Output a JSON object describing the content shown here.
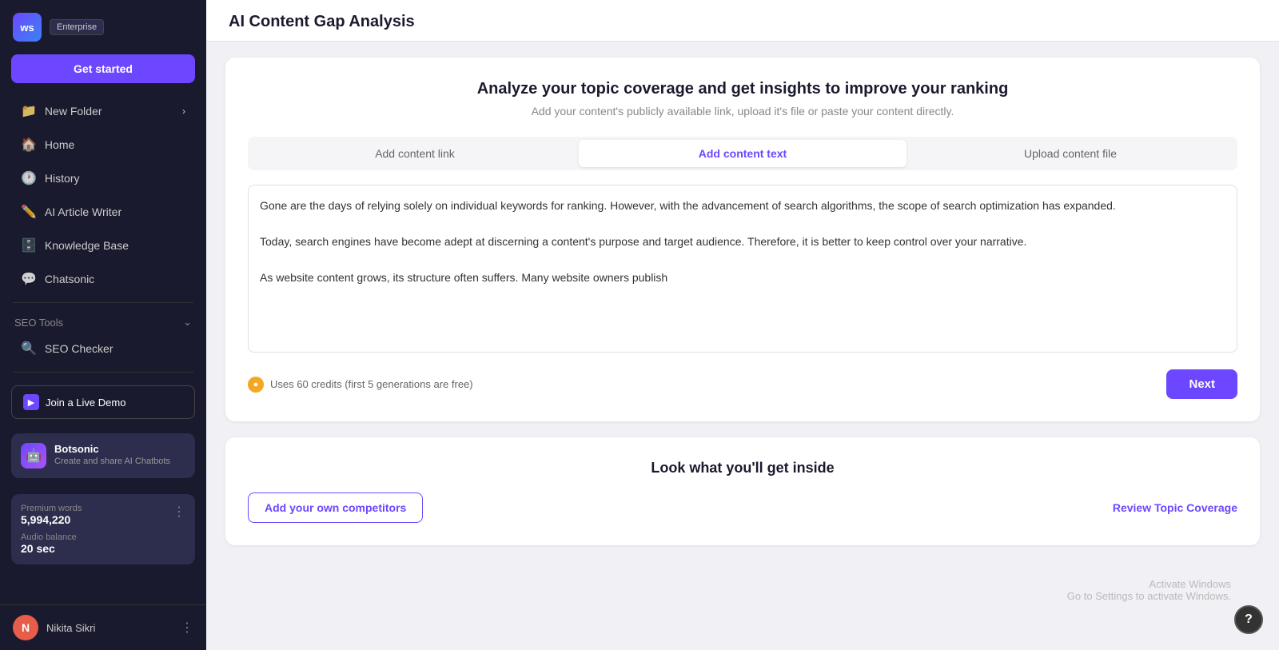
{
  "sidebar": {
    "logo_text": "ws",
    "enterprise_label": "Enterprise",
    "get_started_label": "Get started",
    "items": [
      {
        "id": "new-folder",
        "label": "New Folder",
        "icon": "📁",
        "has_chevron": true
      },
      {
        "id": "home",
        "label": "Home",
        "icon": "🏠",
        "has_chevron": false
      },
      {
        "id": "history",
        "label": "History",
        "icon": "🕐",
        "has_chevron": false
      },
      {
        "id": "ai-article-writer",
        "label": "AI Article Writer",
        "icon": "✏️",
        "has_chevron": false
      },
      {
        "id": "knowledge-base",
        "label": "Knowledge Base",
        "icon": "🗄️",
        "has_chevron": false
      },
      {
        "id": "chatsonic",
        "label": "Chatsonic",
        "icon": "💬",
        "has_chevron": false
      }
    ],
    "seo_tools_label": "SEO Tools",
    "seo_checker_label": "SEO Checker",
    "join_demo_label": "Join a Live Demo",
    "botsonic": {
      "title": "Botsonic",
      "subtitle": "Create and share AI Chatbots"
    },
    "premium_words_label": "Premium words",
    "premium_words_value": "5,994,220",
    "audio_balance_label": "Audio balance",
    "audio_balance_value": "20 sec",
    "user_name": "Nikita Sikri",
    "user_initial": "N"
  },
  "main": {
    "page_title": "AI Content Gap Analysis",
    "card": {
      "heading": "Analyze your topic coverage and get insights to improve your ranking",
      "subheading": "Add your content's publicly available link, upload it's file or paste your content directly.",
      "tabs": [
        {
          "id": "add-content-link",
          "label": "Add content link"
        },
        {
          "id": "add-content-text",
          "label": "Add content text",
          "active": true
        },
        {
          "id": "upload-content-file",
          "label": "Upload content file"
        }
      ],
      "textarea_content": "Gone are the days of relying solely on individual keywords for ranking. However, with the advancement of search algorithms, the scope of search optimization has expanded.\n\nToday, search engines have become adept at discerning a content's purpose and target audience. Therefore, it is better to keep control over your narrative.\n\nAs website content grows, its structure often suffers. Many website owners publish",
      "credits_text": "Uses 60 credits (first 5 generations are free)",
      "next_button": "Next"
    },
    "look_card": {
      "heading": "Look what you'll get inside",
      "competitors_btn": "Add your own competitors",
      "review_link": "Review Topic Coverage"
    },
    "activate_windows": {
      "line1": "Activate Windows",
      "line2": "Go to Settings to activate Windows."
    },
    "help_icon": "?"
  }
}
